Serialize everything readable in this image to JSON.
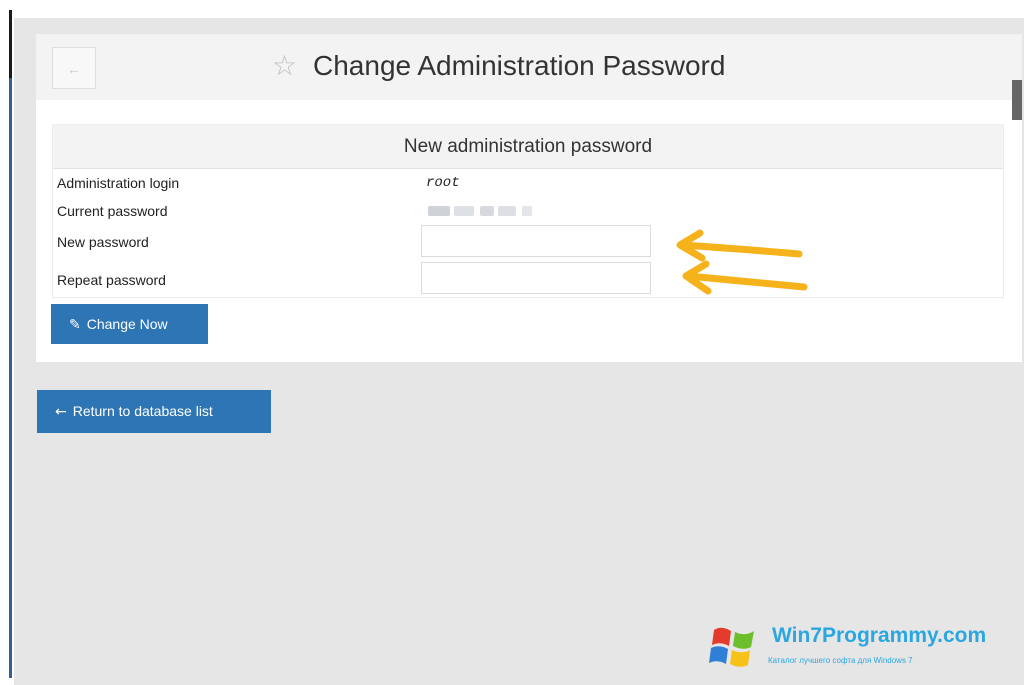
{
  "header": {
    "back_icon": "arrow-left-icon",
    "star_icon": "star-outline-icon",
    "star_glyph": "☆",
    "title": "Change Administration Password"
  },
  "form": {
    "caption": "New administration password",
    "fields": [
      {
        "label": "Administration login",
        "value": "root"
      },
      {
        "label": "Current password",
        "value": ""
      },
      {
        "label": "New password",
        "value": "",
        "placeholder": ""
      },
      {
        "label": "Repeat password",
        "value": "",
        "placeholder": ""
      }
    ],
    "submit": {
      "icon": "edit-icon",
      "icon_glyph": "✎",
      "label": "Change Now"
    }
  },
  "return_button": {
    "icon": "arrow-left-icon",
    "icon_glyph": "←",
    "label": "Return to database list"
  },
  "watermark": {
    "logo": "windows-flag-logo",
    "title": "Win7Programmy.com",
    "subtitle": "Каталог лучшего софта для Windows 7"
  },
  "colors": {
    "background": "#e6e6e6",
    "panel": "#ffffff",
    "header": "#f3f3f3",
    "button": "#2e75b6",
    "arrow": "#f5b21a",
    "watermark": "#2aa7e0"
  }
}
